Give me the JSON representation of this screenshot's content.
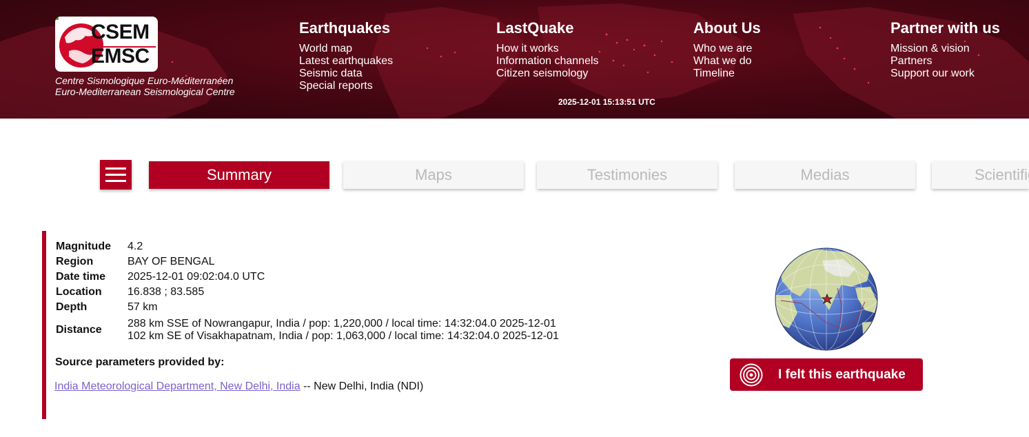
{
  "header": {
    "logo_line1": "CSEM",
    "logo_line2": "EMSC",
    "org_fr": "Centre Sismologique Euro-Méditerranéen",
    "org_en": "Euro-Mediterranean Seismological Centre",
    "clock": "2025-12-01 15:13:51 UTC",
    "nav": [
      {
        "title": "Earthquakes",
        "links": [
          "World map",
          "Latest earthquakes",
          "Seismic data",
          "Special reports"
        ]
      },
      {
        "title": "LastQuake",
        "links": [
          "How it works",
          "Information channels",
          "Citizen seismology"
        ]
      },
      {
        "title": "About Us",
        "links": [
          "Who we are",
          "What we do",
          "Timeline"
        ]
      },
      {
        "title": "Partner with us",
        "links": [
          "Mission & vision",
          "Partners",
          "Support our work"
        ]
      }
    ]
  },
  "tabs": [
    "Summary",
    "Maps",
    "Testimonies",
    "Medias",
    "Scientific"
  ],
  "summary": {
    "magnitude_label": "Magnitude",
    "magnitude": "4.2",
    "region_label": "Region",
    "region": "BAY OF BENGAL",
    "datetime_label": "Date time",
    "datetime": "2025-12-01 09:02:04.0 UTC",
    "location_label": "Location",
    "location": "16.838 ; 83.585",
    "depth_label": "Depth",
    "depth": "57 km",
    "distance_label": "Distance",
    "distance_1": "288 km SSE of Nowrangapur, India / pop: 1,220,000 / local time: 14:32:04.0 2025-12-01",
    "distance_2": "102 km SE of Visakhapatnam, India / pop: 1,063,000 / local time: 14:32:04.0 2025-12-01",
    "source_title": "Source parameters provided by:",
    "source_link": "India Meteorological Department, New Delhi, India",
    "source_rest": " -- New Delhi, India (NDI)"
  },
  "felt_button": "I felt this earthquake",
  "icons": {
    "menu": "hamburger-icon",
    "felt": "ripple-icon",
    "globe": "globe-icon",
    "epicenter": "star-icon"
  },
  "colors": {
    "brand": "#b10022",
    "header_bg": "#4a0713",
    "tab_inactive_bg": "#f6f6f6",
    "tab_inactive_text": "#b9b9b9",
    "link": "#7a63c9"
  }
}
